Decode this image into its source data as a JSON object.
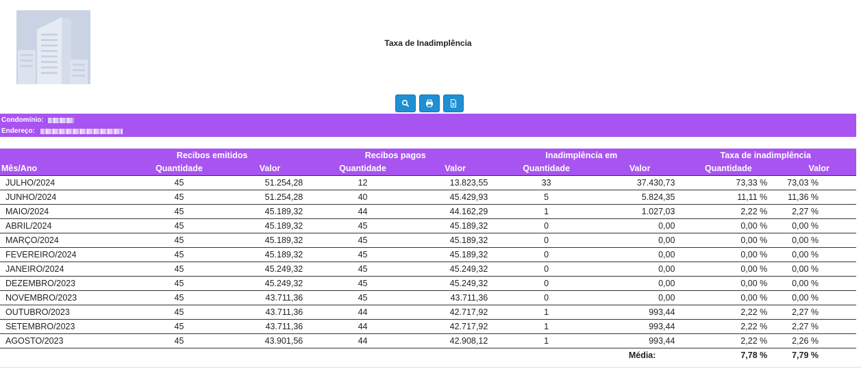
{
  "header": {
    "title": "Taxa de Inadimplência"
  },
  "toolbar": {
    "buttons": [
      "search-icon",
      "print-icon",
      "excel-icon"
    ]
  },
  "info": {
    "condominio_label": "Condomínio:",
    "endereco_label": "Endereço:"
  },
  "table": {
    "group_headers": [
      "Recibos emitidos",
      "Recibos pagos",
      "Inadimplência em",
      "Taxa de inadimplência"
    ],
    "sub_headers": {
      "mes": "Mês/Ano",
      "qtd": "Quantidade",
      "valor": "Valor"
    },
    "rows": [
      [
        "JULHO/2024",
        "45",
        "51.254,28",
        "12",
        "13.823,55",
        "33",
        "37.430,73",
        "73,33 %",
        "73,03 %"
      ],
      [
        "JUNHO/2024",
        "45",
        "51.254,28",
        "40",
        "45.429,93",
        "5",
        "5.824,35",
        "11,11 %",
        "11,36 %"
      ],
      [
        "MAIO/2024",
        "45",
        "45.189,32",
        "44",
        "44.162,29",
        "1",
        "1.027,03",
        "2,22 %",
        "2,27 %"
      ],
      [
        "ABRIL/2024",
        "45",
        "45.189,32",
        "45",
        "45.189,32",
        "0",
        "0,00",
        "0,00 %",
        "0,00 %"
      ],
      [
        "MARÇO/2024",
        "45",
        "45.189,32",
        "45",
        "45.189,32",
        "0",
        "0,00",
        "0,00 %",
        "0,00 %"
      ],
      [
        "FEVEREIRO/2024",
        "45",
        "45.189,32",
        "45",
        "45.189,32",
        "0",
        "0,00",
        "0,00 %",
        "0,00 %"
      ],
      [
        "JANEIRO/2024",
        "45",
        "45.249,32",
        "45",
        "45.249,32",
        "0",
        "0,00",
        "0,00 %",
        "0,00 %"
      ],
      [
        "DEZEMBRO/2023",
        "45",
        "45.249,32",
        "45",
        "45.249,32",
        "0",
        "0,00",
        "0,00 %",
        "0,00 %"
      ],
      [
        "NOVEMBRO/2023",
        "45",
        "43.711,36",
        "45",
        "43.711,36",
        "0",
        "0,00",
        "0,00 %",
        "0,00 %"
      ],
      [
        "OUTUBRO/2023",
        "45",
        "43.711,36",
        "44",
        "42.717,92",
        "1",
        "993,44",
        "2,22 %",
        "2,27 %"
      ],
      [
        "SETEMBRO/2023",
        "45",
        "43.711,36",
        "44",
        "42.717,92",
        "1",
        "993,44",
        "2,22 %",
        "2,27 %"
      ],
      [
        "AGOSTO/2023",
        "45",
        "43.901,56",
        "44",
        "42.908,12",
        "1",
        "993,44",
        "2,22 %",
        "2,26 %"
      ]
    ],
    "footer": {
      "label": "Média:",
      "qtd": "7,78 %",
      "valor": "7,79 %"
    }
  },
  "colors": {
    "accent": "#a854f0",
    "button": "#1e8fd2",
    "logo_bg": "#c9d3e3"
  }
}
